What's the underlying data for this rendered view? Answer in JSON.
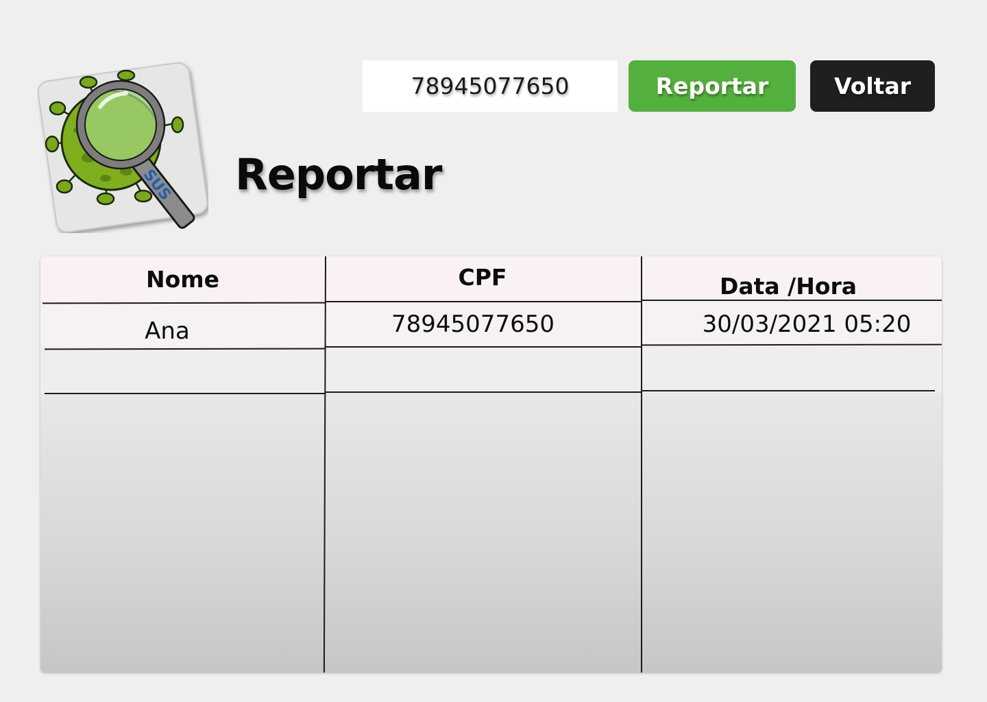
{
  "header": {
    "title": "Reportar",
    "logo_text": "SUS",
    "logo_icon": "virus-magnifier-icon"
  },
  "search": {
    "cpf_value": "78945077650"
  },
  "toolbar": {
    "report_label": "Reportar",
    "back_label": "Voltar"
  },
  "table": {
    "columns": [
      "Nome",
      "CPF",
      "Data /Hora"
    ],
    "rows": [
      [
        "Ana",
        "78945077650",
        "30/03/2021 05:20"
      ],
      [
        "",
        "",
        ""
      ]
    ]
  },
  "colors": {
    "report_button": "#54b03c",
    "back_button": "#1e1f1f",
    "background": "#efefef"
  }
}
